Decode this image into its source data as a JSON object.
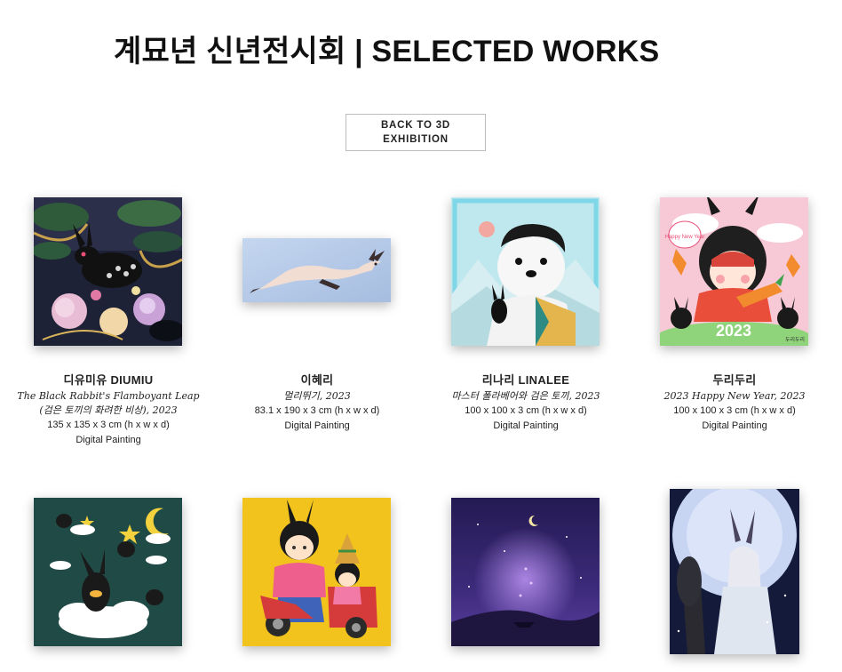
{
  "page": {
    "title": "계묘년 신년전시회 | SELECTED WORKS",
    "back_button_label": "BACK TO 3D EXHIBITION"
  },
  "works": [
    {
      "artist": "디유미유 DIUMIU",
      "title": "The Black Rabbit's Flamboyant Leap (검은 토끼의 화려한 비상), 2023",
      "dimensions": "135 x 135 x 3 cm (h x w x d)",
      "medium": "Digital Painting"
    },
    {
      "artist": "이혜리",
      "title": "멀리뛰기, 2023",
      "dimensions": "83.1 x 190 x 3 cm (h x w x d)",
      "medium": "Digital Painting"
    },
    {
      "artist": "리나리 LINALEE",
      "title": "마스터 폴라베어와 검은 토끼, 2023",
      "dimensions": "100 x 100 x 3 cm (h x w x d)",
      "medium": "Digital Painting"
    },
    {
      "artist": "두리두리",
      "title": "2023 Happy New Year, 2023",
      "dimensions": "100 x 100 x 3 cm (h x w x d)",
      "medium": "Digital Painting"
    }
  ],
  "artwork_text": {
    "art4_year": "2023",
    "art4_signature": "두리두리",
    "art4_bubble": "Happy New Year"
  },
  "colors": {
    "text": "#111111",
    "button_border": "#bdbdbd",
    "art4_background": "#f7c9d6"
  }
}
